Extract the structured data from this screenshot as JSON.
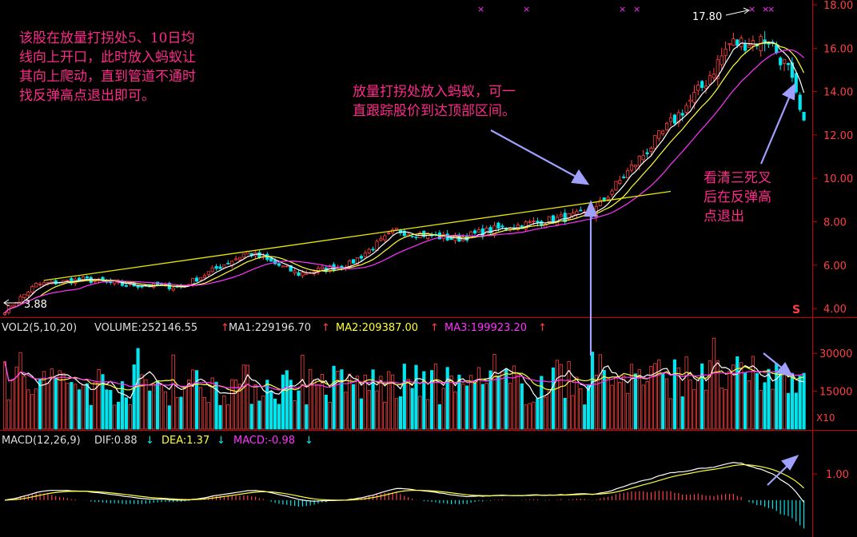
{
  "price_panel": {
    "y_ticks": [
      "18.00",
      "16.00",
      "14.00",
      "12.00",
      "10.00",
      "8.00",
      "6.00",
      "4.00"
    ],
    "high_label": "17.80",
    "low_label": "3.88",
    "s_mark": "S"
  },
  "volume_panel": {
    "indicator_label": "VOL2(5,10,20)",
    "volume_label": "VOLUME:252146.55",
    "ma1_label": "MA1:229196.70",
    "ma2_label": "MA2:209387.00",
    "ma3_label": "MA3:199923.20",
    "y_ticks": [
      "30000",
      "15000"
    ],
    "multiplier": "X10"
  },
  "macd_panel": {
    "indicator_label": "MACD(12,26,9)",
    "dif_label": "DIF:0.88",
    "dea_label": "DEA:1.37",
    "macd_label": "MACD:-0.98",
    "y_tick": "1.00"
  },
  "annotations": {
    "left_note": "该股在放量打拐处5、10日均\n线向上开口，此时放入蚂蚁让\n其向上爬动，直到管道不通时\n找反弹高点退出即可。",
    "middle_note": "放量打拐处放入蚂蚁，可一\n直跟踪股价到达顶部区间。",
    "right_note": "看清三死叉\n后在反弹高\n点退出"
  },
  "colors": {
    "up": "#ff4040",
    "down": "#00e5ee",
    "ma_white": "#ffffff",
    "ma_yellow": "#ffff33",
    "ma_magenta": "#ff33ff",
    "annotation": "#ff2a8a",
    "arrow": "#9999ff",
    "axis": "#cc0000"
  },
  "chart_data": {
    "type": "candlestick",
    "title": "",
    "price": {
      "ylim": [
        3.6,
        18.0
      ],
      "high": 17.8,
      "low": 3.88,
      "keypoints": [
        [
          0,
          3.9
        ],
        [
          8,
          5.1
        ],
        [
          20,
          5.35
        ],
        [
          30,
          5.1
        ],
        [
          45,
          5.0
        ],
        [
          62,
          6.6
        ],
        [
          75,
          5.6
        ],
        [
          88,
          6.05
        ],
        [
          100,
          7.6
        ],
        [
          115,
          7.2
        ],
        [
          125,
          7.65
        ],
        [
          140,
          8.1
        ],
        [
          150,
          8.4
        ],
        [
          158,
          10.1
        ],
        [
          168,
          12.1
        ],
        [
          178,
          14.2
        ],
        [
          185,
          16.2
        ],
        [
          195,
          16.4
        ],
        [
          200,
          15.0
        ],
        [
          204,
          12.4
        ]
      ],
      "trendline": {
        "from": [
          10,
          5.3
        ],
        "to": [
          170,
          9.4
        ]
      }
    },
    "volume": {
      "ylim": [
        0,
        37000
      ],
      "ticks": [
        30000,
        15000
      ],
      "multiplier": "X10"
    },
    "macd": {
      "ylim": [
        -1.4,
        2.0
      ],
      "dif": 0.88,
      "dea": 1.37,
      "macd": -0.98
    }
  }
}
